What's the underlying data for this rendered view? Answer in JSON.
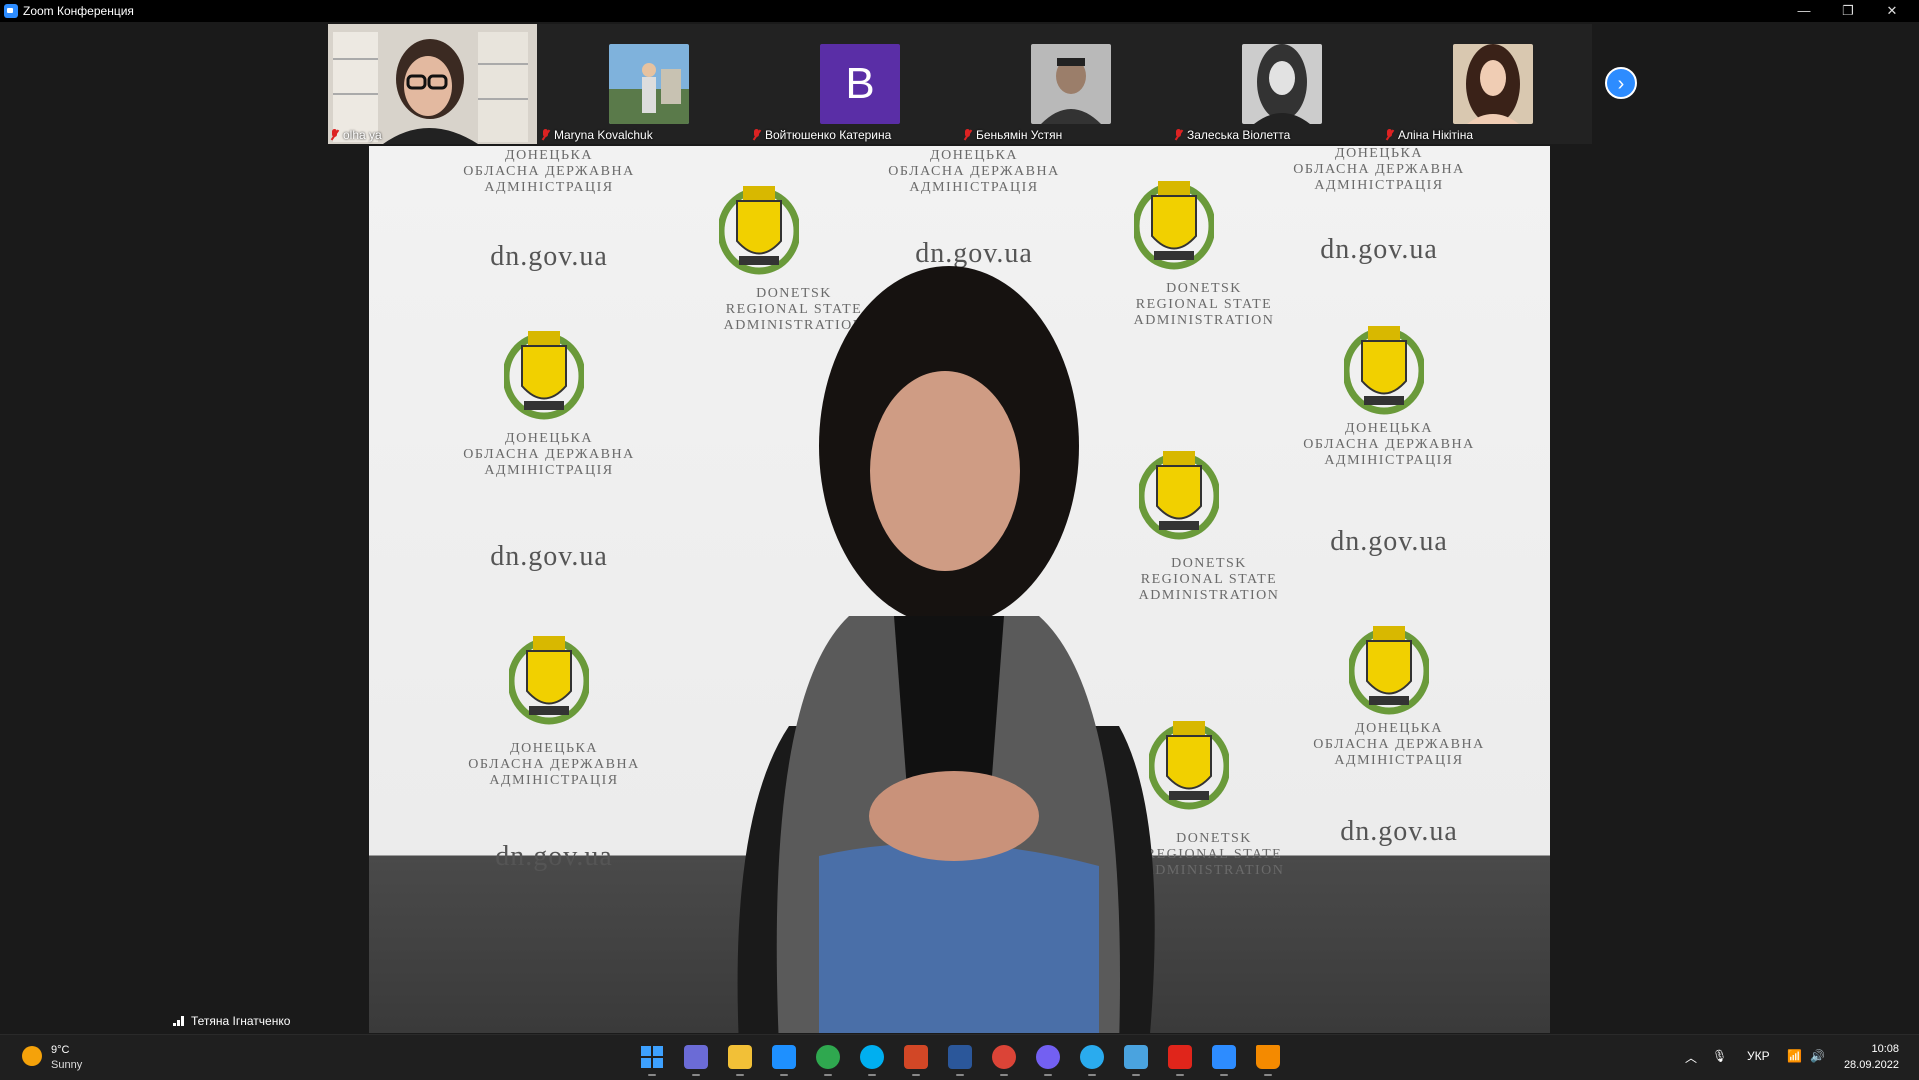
{
  "window": {
    "title": "Zoom Конференция",
    "minimize_icon": "—",
    "restore_icon": "❐",
    "close_icon": "✕"
  },
  "participants": [
    {
      "name": "olha ya",
      "muted": true,
      "active": true
    },
    {
      "name": "Maryna Kovalchuk",
      "muted": true
    },
    {
      "name": "Войтюшенко Катерина",
      "muted": true,
      "initial": "B",
      "avatar_color": "#5a2ea6"
    },
    {
      "name": "Беньямін Устян",
      "muted": true
    },
    {
      "name": "Залеська Віолетта",
      "muted": true
    },
    {
      "name": "Аліна Нікітіна",
      "muted": true
    }
  ],
  "next_page_icon": "›",
  "main_video": {
    "speaker_name": "Тетяна Ігнатченко",
    "backdrop": {
      "ua_caption": [
        "ДОНЕЦЬКА",
        "ОБЛАСНА ДЕРЖАВНА",
        "АДМІНІСТРАЦІЯ"
      ],
      "en_caption": [
        "DONETSK",
        "REGIONAL STATE",
        "ADMINISTRATION"
      ],
      "url": "dn.gov.ua"
    }
  },
  "taskbar": {
    "weather": {
      "temp": "9°C",
      "condition": "Sunny"
    },
    "apps": [
      "windows-start",
      "zoom-meetings",
      "file-explorer",
      "store",
      "chrome",
      "skype",
      "powerpoint",
      "word",
      "chrome-2",
      "viber",
      "telegram",
      "notepad",
      "acrobat",
      "zoom",
      "vlc"
    ],
    "language": "УКР",
    "time": "10:08",
    "date": "28.09.2022"
  },
  "colors": {
    "accent": "#2d8cff",
    "muted_red": "#d22"
  }
}
